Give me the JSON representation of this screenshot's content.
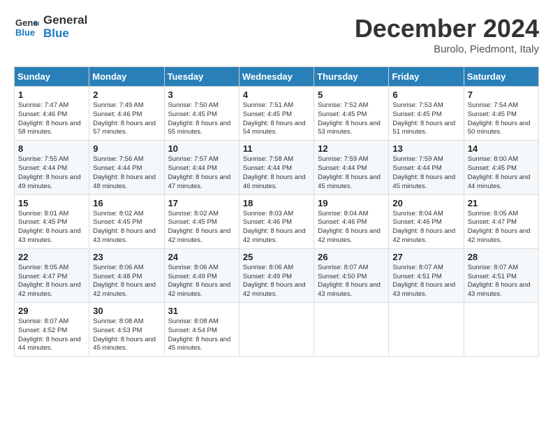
{
  "header": {
    "logo": {
      "line1": "General",
      "line2": "Blue"
    },
    "month_title": "December 2024",
    "subtitle": "Burolo, Piedmont, Italy"
  },
  "days_of_week": [
    "Sunday",
    "Monday",
    "Tuesday",
    "Wednesday",
    "Thursday",
    "Friday",
    "Saturday"
  ],
  "weeks": [
    [
      {
        "day": 1,
        "sunrise": "Sunrise: 7:47 AM",
        "sunset": "Sunset: 4:46 PM",
        "daylight": "Daylight: 8 hours and 58 minutes."
      },
      {
        "day": 2,
        "sunrise": "Sunrise: 7:49 AM",
        "sunset": "Sunset: 4:46 PM",
        "daylight": "Daylight: 8 hours and 57 minutes."
      },
      {
        "day": 3,
        "sunrise": "Sunrise: 7:50 AM",
        "sunset": "Sunset: 4:45 PM",
        "daylight": "Daylight: 8 hours and 55 minutes."
      },
      {
        "day": 4,
        "sunrise": "Sunrise: 7:51 AM",
        "sunset": "Sunset: 4:45 PM",
        "daylight": "Daylight: 8 hours and 54 minutes."
      },
      {
        "day": 5,
        "sunrise": "Sunrise: 7:52 AM",
        "sunset": "Sunset: 4:45 PM",
        "daylight": "Daylight: 8 hours and 53 minutes."
      },
      {
        "day": 6,
        "sunrise": "Sunrise: 7:53 AM",
        "sunset": "Sunset: 4:45 PM",
        "daylight": "Daylight: 8 hours and 51 minutes."
      },
      {
        "day": 7,
        "sunrise": "Sunrise: 7:54 AM",
        "sunset": "Sunset: 4:45 PM",
        "daylight": "Daylight: 8 hours and 50 minutes."
      }
    ],
    [
      {
        "day": 8,
        "sunrise": "Sunrise: 7:55 AM",
        "sunset": "Sunset: 4:44 PM",
        "daylight": "Daylight: 8 hours and 49 minutes."
      },
      {
        "day": 9,
        "sunrise": "Sunrise: 7:56 AM",
        "sunset": "Sunset: 4:44 PM",
        "daylight": "Daylight: 8 hours and 48 minutes."
      },
      {
        "day": 10,
        "sunrise": "Sunrise: 7:57 AM",
        "sunset": "Sunset: 4:44 PM",
        "daylight": "Daylight: 8 hours and 47 minutes."
      },
      {
        "day": 11,
        "sunrise": "Sunrise: 7:58 AM",
        "sunset": "Sunset: 4:44 PM",
        "daylight": "Daylight: 8 hours and 46 minutes."
      },
      {
        "day": 12,
        "sunrise": "Sunrise: 7:59 AM",
        "sunset": "Sunset: 4:44 PM",
        "daylight": "Daylight: 8 hours and 45 minutes."
      },
      {
        "day": 13,
        "sunrise": "Sunrise: 7:59 AM",
        "sunset": "Sunset: 4:44 PM",
        "daylight": "Daylight: 8 hours and 45 minutes."
      },
      {
        "day": 14,
        "sunrise": "Sunrise: 8:00 AM",
        "sunset": "Sunset: 4:45 PM",
        "daylight": "Daylight: 8 hours and 44 minutes."
      }
    ],
    [
      {
        "day": 15,
        "sunrise": "Sunrise: 8:01 AM",
        "sunset": "Sunset: 4:45 PM",
        "daylight": "Daylight: 8 hours and 43 minutes."
      },
      {
        "day": 16,
        "sunrise": "Sunrise: 8:02 AM",
        "sunset": "Sunset: 4:45 PM",
        "daylight": "Daylight: 8 hours and 43 minutes."
      },
      {
        "day": 17,
        "sunrise": "Sunrise: 8:02 AM",
        "sunset": "Sunset: 4:45 PM",
        "daylight": "Daylight: 8 hours and 42 minutes."
      },
      {
        "day": 18,
        "sunrise": "Sunrise: 8:03 AM",
        "sunset": "Sunset: 4:46 PM",
        "daylight": "Daylight: 8 hours and 42 minutes."
      },
      {
        "day": 19,
        "sunrise": "Sunrise: 8:04 AM",
        "sunset": "Sunset: 4:46 PM",
        "daylight": "Daylight: 8 hours and 42 minutes."
      },
      {
        "day": 20,
        "sunrise": "Sunrise: 8:04 AM",
        "sunset": "Sunset: 4:46 PM",
        "daylight": "Daylight: 8 hours and 42 minutes."
      },
      {
        "day": 21,
        "sunrise": "Sunrise: 8:05 AM",
        "sunset": "Sunset: 4:47 PM",
        "daylight": "Daylight: 8 hours and 42 minutes."
      }
    ],
    [
      {
        "day": 22,
        "sunrise": "Sunrise: 8:05 AM",
        "sunset": "Sunset: 4:47 PM",
        "daylight": "Daylight: 8 hours and 42 minutes."
      },
      {
        "day": 23,
        "sunrise": "Sunrise: 8:06 AM",
        "sunset": "Sunset: 4:48 PM",
        "daylight": "Daylight: 8 hours and 42 minutes."
      },
      {
        "day": 24,
        "sunrise": "Sunrise: 8:06 AM",
        "sunset": "Sunset: 4:49 PM",
        "daylight": "Daylight: 8 hours and 42 minutes."
      },
      {
        "day": 25,
        "sunrise": "Sunrise: 8:06 AM",
        "sunset": "Sunset: 4:49 PM",
        "daylight": "Daylight: 8 hours and 42 minutes."
      },
      {
        "day": 26,
        "sunrise": "Sunrise: 8:07 AM",
        "sunset": "Sunset: 4:50 PM",
        "daylight": "Daylight: 8 hours and 43 minutes."
      },
      {
        "day": 27,
        "sunrise": "Sunrise: 8:07 AM",
        "sunset": "Sunset: 4:51 PM",
        "daylight": "Daylight: 8 hours and 43 minutes."
      },
      {
        "day": 28,
        "sunrise": "Sunrise: 8:07 AM",
        "sunset": "Sunset: 4:51 PM",
        "daylight": "Daylight: 8 hours and 43 minutes."
      }
    ],
    [
      {
        "day": 29,
        "sunrise": "Sunrise: 8:07 AM",
        "sunset": "Sunset: 4:52 PM",
        "daylight": "Daylight: 8 hours and 44 minutes."
      },
      {
        "day": 30,
        "sunrise": "Sunrise: 8:08 AM",
        "sunset": "Sunset: 4:53 PM",
        "daylight": "Daylight: 8 hours and 45 minutes."
      },
      {
        "day": 31,
        "sunrise": "Sunrise: 8:08 AM",
        "sunset": "Sunset: 4:54 PM",
        "daylight": "Daylight: 8 hours and 45 minutes."
      },
      null,
      null,
      null,
      null
    ]
  ]
}
